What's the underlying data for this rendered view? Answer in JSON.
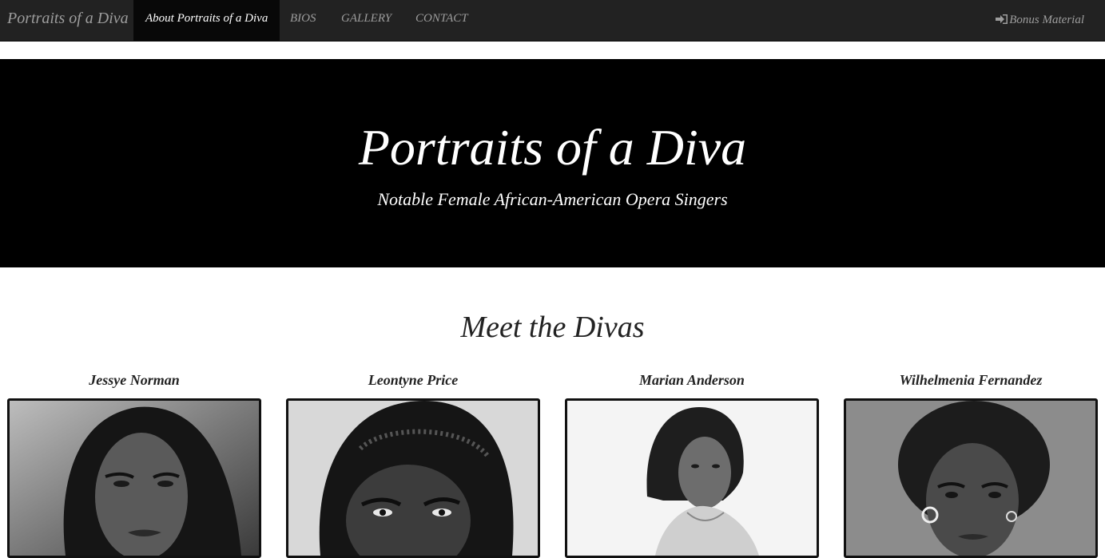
{
  "navbar": {
    "brand": "Portraits of a Diva",
    "items": [
      {
        "label": "About Portraits of a Diva",
        "active": true
      },
      {
        "label": "BIOS"
      },
      {
        "label": "GALLERY"
      },
      {
        "label": "CONTACT"
      }
    ],
    "right_link": {
      "label": "Bonus Material",
      "icon": "sign-in-icon"
    }
  },
  "hero": {
    "title": "Portraits of a Diva",
    "subtitle": "Notable Female African-American Opera Singers"
  },
  "section": {
    "title": "Meet the Divas",
    "divas": [
      {
        "name": "Jessye Norman"
      },
      {
        "name": "Leontyne Price"
      },
      {
        "name": "Marian Anderson"
      },
      {
        "name": "Wilhelmenia Fernandez"
      }
    ]
  },
  "colors": {
    "navbar_bg": "#222222",
    "nav_text": "#9d9d9d",
    "hero_bg": "#000000",
    "hero_text": "#ffffff"
  }
}
